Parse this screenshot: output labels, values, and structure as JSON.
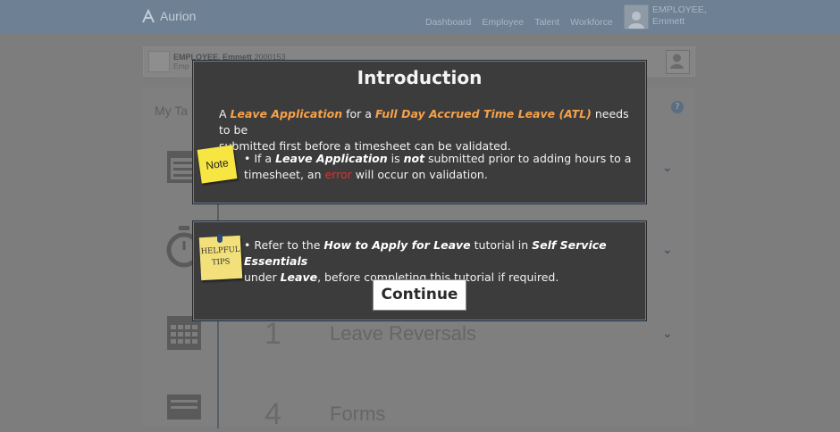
{
  "app": {
    "logo_text": "Aurion",
    "nav": [
      "Dashboard",
      "Employee",
      "Talent",
      "Workforce"
    ],
    "user_line1": "EMPLOYEE,",
    "user_line2": "Emmett"
  },
  "employee_bar": {
    "name": "EMPLOYEE, Emmett",
    "id": "2000153",
    "sub": "Emp"
  },
  "tasks_panel": {
    "title": "My Ta",
    "items": [
      {
        "icon": "calendar-icon",
        "number": "",
        "label": ""
      },
      {
        "icon": "stopwatch-icon",
        "number": "",
        "label": ""
      },
      {
        "icon": "calendar-grid-icon",
        "number": "1",
        "label": "Leave Reversals"
      },
      {
        "icon": "form-icon",
        "number": "4",
        "label": "Forms"
      }
    ]
  },
  "intro_dialog": {
    "title": "Introduction",
    "p1_a": "A ",
    "p1_b": "Leave Application",
    "p1_c": " for a ",
    "p1_d": "Full Day Accrued Time Leave (ATL)",
    "p1_e": " needs to be",
    "p1_f": "submitted first before a timesheet can be validated.",
    "note_label": "Note",
    "p2_a": "If a ",
    "p2_b": "Leave Application",
    "p2_c": " is ",
    "p2_d": "not",
    "p2_e": " submitted prior to adding hours to a",
    "p2_f": "timesheet, an ",
    "p2_g": "error",
    "p2_h": " will occur on validation."
  },
  "tips_dialog": {
    "sticky_line1": "HELPFUL",
    "sticky_line2": "TIPS",
    "t_a": "Refer to the ",
    "t_b": "How to Apply for Leave",
    "t_c": " tutorial in ",
    "t_d": "Self Service Essentials",
    "t_e": "under ",
    "t_f": "Leave",
    "t_g": ", before completing this tutorial if required.",
    "continue_label": "Continue"
  },
  "colors": {
    "accent_orange": "#f5a14a",
    "error_red": "#e2322d",
    "dialog_bg": "#3c3c3c",
    "note_yellow": "#f7e542"
  }
}
